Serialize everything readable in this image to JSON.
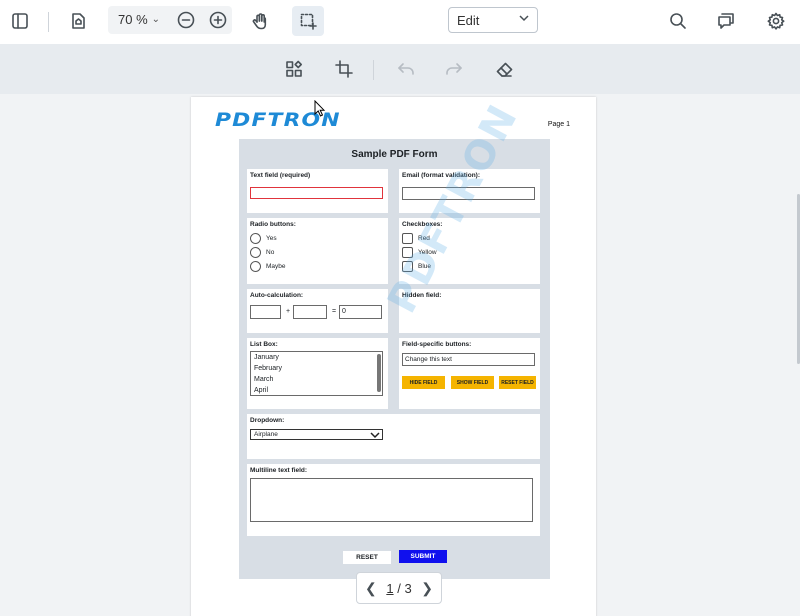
{
  "toolbar": {
    "zoom": "70 %",
    "mode": "Edit"
  },
  "document": {
    "logo": "PDFTRON",
    "page_label": "Page 1",
    "watermark": "PDFTRON",
    "form": {
      "title": "Sample PDF Form",
      "text_field_label": "Text field (required)",
      "email_label": "Email (format validation):",
      "radio_label": "Radio buttons:",
      "radio_options": [
        "Yes",
        "No",
        "Maybe"
      ],
      "checkbox_label": "Checkboxes:",
      "checkbox_options": [
        "Red",
        "Yellow",
        "Blue"
      ],
      "autocalc_label": "Auto-calculation:",
      "autocalc_plus": "+",
      "autocalc_equals": "=",
      "autocalc_result": "0",
      "hidden_label": "Hidden field:",
      "listbox_label": "List Box:",
      "listbox_items": [
        "January",
        "February",
        "March",
        "April"
      ],
      "field_buttons_label": "Field-specific buttons:",
      "field_buttons_input": "Change this text",
      "hide_field": "HIDE FIELD",
      "show_field": "SHOW FIELD",
      "reset_field": "RESET FIELD",
      "dropdown_label": "Dropdown:",
      "dropdown_value": "Airplane",
      "multiline_label": "Multiline text field:",
      "reset": "RESET",
      "submit": "SUBMIT"
    }
  },
  "pager": {
    "current": "1",
    "separator": "/",
    "total": "3"
  }
}
